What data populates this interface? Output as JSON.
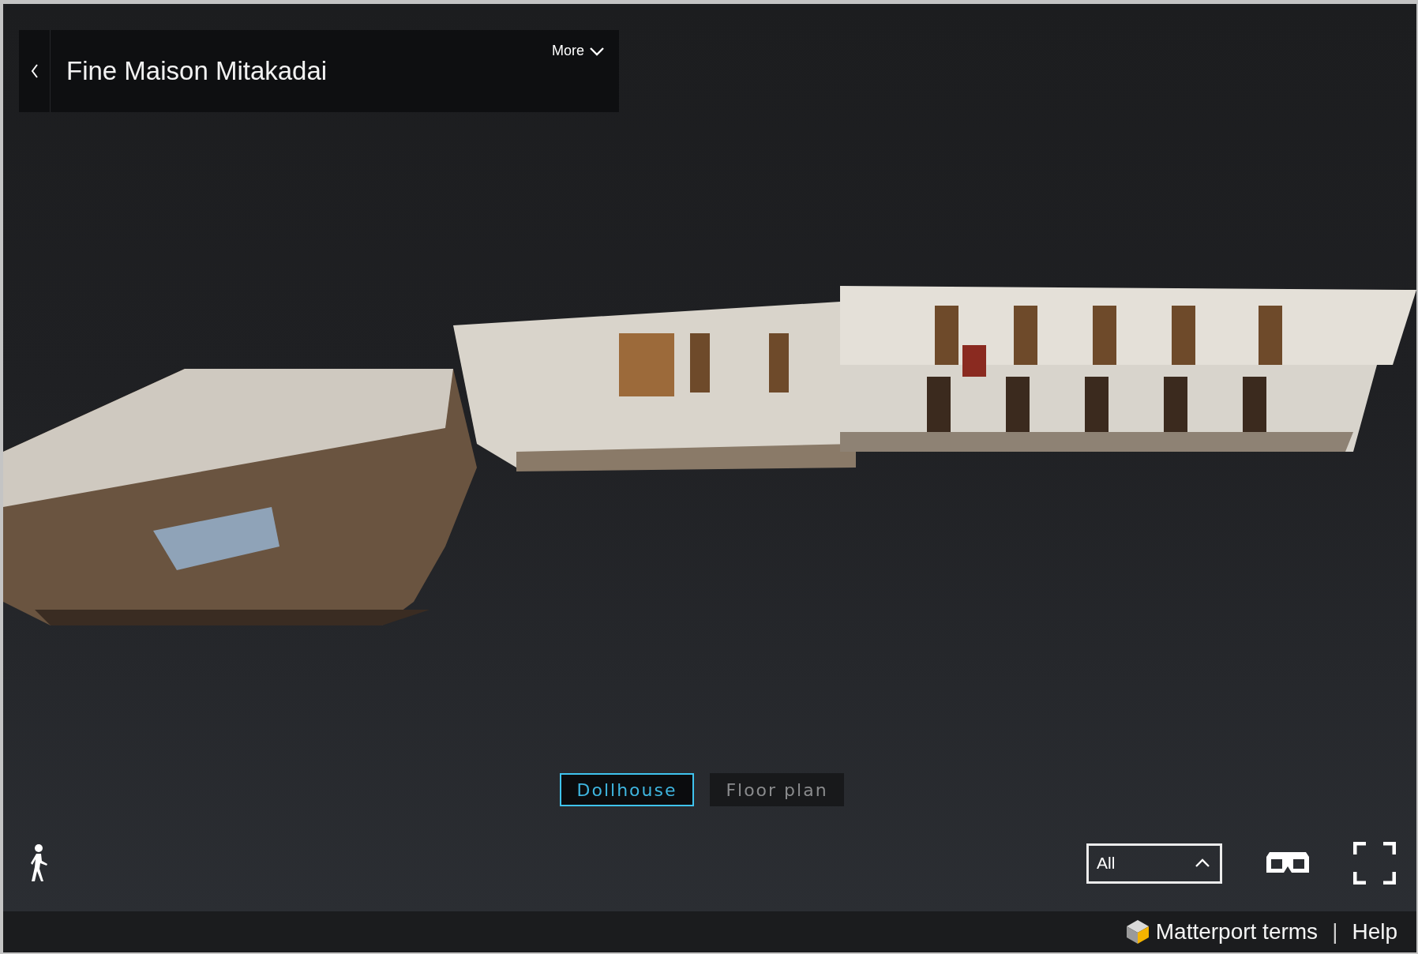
{
  "header": {
    "title": "Fine Maison Mitakadai",
    "more": "More"
  },
  "view_modes": [
    {
      "label": "Dollhouse",
      "selected": true
    },
    {
      "label": "Floor plan",
      "selected": false
    }
  ],
  "floor_select": {
    "value": "All"
  },
  "footer": {
    "terms": "Matterport terms",
    "separator": "|",
    "help": "Help"
  }
}
